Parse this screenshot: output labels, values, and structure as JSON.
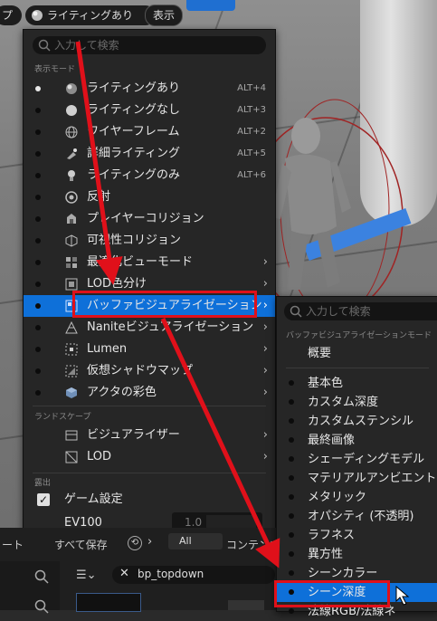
{
  "viewport_toolbar": {
    "left_fragment": "プ",
    "lighting_button": "ライティングあり",
    "show_button": "表示"
  },
  "main_menu": {
    "search_placeholder": "入力して検索",
    "section_view_mode": "表示モード",
    "view_modes": [
      {
        "label": "ライティングあり",
        "shortcut": "ALT+4",
        "active": true,
        "icon": "sphere-lit-icon"
      },
      {
        "label": "ライティングなし",
        "shortcut": "ALT+3",
        "active": false,
        "icon": "sphere-unlit-icon"
      },
      {
        "label": "ワイヤーフレーム",
        "shortcut": "ALT+2",
        "active": false,
        "icon": "wireframe-globe-icon"
      },
      {
        "label": "詳細ライティング",
        "shortcut": "ALT+5",
        "active": false,
        "icon": "detail-lighting-icon"
      },
      {
        "label": "ライティングのみ",
        "shortcut": "ALT+6",
        "active": false,
        "icon": "lightbulb-icon"
      },
      {
        "label": "反射",
        "shortcut": "",
        "active": false,
        "icon": "reflection-icon"
      },
      {
        "label": "プレイヤーコリジョン",
        "shortcut": "",
        "active": false,
        "icon": "player-collision-icon"
      },
      {
        "label": "可視性コリジョン",
        "shortcut": "",
        "active": false,
        "icon": "visibility-collision-icon"
      },
      {
        "label": "最適化ビューモード",
        "shortcut": "",
        "active": false,
        "icon": "optimization-icon",
        "submenu": true
      },
      {
        "label": "LOD色分け",
        "shortcut": "",
        "active": false,
        "icon": "lod-color-icon",
        "submenu": true
      },
      {
        "label": "バッファビジュアライゼーション",
        "shortcut": "",
        "active": false,
        "icon": "buffer-icon",
        "submenu": true,
        "selected": true
      },
      {
        "label": "Naniteビジュアライゼーション",
        "shortcut": "",
        "active": false,
        "icon": "nanite-icon",
        "submenu": true
      },
      {
        "label": "Lumen",
        "shortcut": "",
        "active": false,
        "icon": "lumen-icon",
        "submenu": true
      },
      {
        "label": "仮想シャドウマップ",
        "shortcut": "",
        "active": false,
        "icon": "virtual-shadow-icon",
        "submenu": true
      },
      {
        "label": "アクタの彩色",
        "shortcut": "",
        "active": false,
        "icon": "actor-color-icon",
        "submenu": true
      }
    ],
    "section_landscape": "ランドスケープ",
    "landscape_items": [
      {
        "label": "ビジュアライザー",
        "icon": "visualizer-icon"
      },
      {
        "label": "LOD",
        "icon": "lod-icon"
      }
    ],
    "section_exposure": "露出",
    "game_settings": "ゲーム設定",
    "ev100_label": "EV100",
    "ev100_value": "1.0"
  },
  "sub_menu": {
    "search_placeholder": "入力して検索",
    "section_title": "バッファビジュアライゼーションモード",
    "overview": "概要",
    "items": [
      "基本色",
      "カスタム深度",
      "カスタムステンシル",
      "最終画像",
      "シェーディングモデル",
      "マテリアルアンビエントオ",
      "メタリック",
      "オパシティ (不透明)",
      "ラフネス",
      "異方性",
      "シーンカラー",
      "シーン深度",
      "法線RGB/法線ネ"
    ],
    "selected_index": 11
  },
  "bottom_panel": {
    "left_fragment": "ート",
    "save_all": "すべて保存",
    "filter_all": "All",
    "content_fragment": "コンテンツ",
    "search_value": "bp_topdown"
  },
  "colors": {
    "menu_bg": "#262626",
    "selection_blue": "#0e70d9",
    "annotation_red": "#e0101a"
  }
}
